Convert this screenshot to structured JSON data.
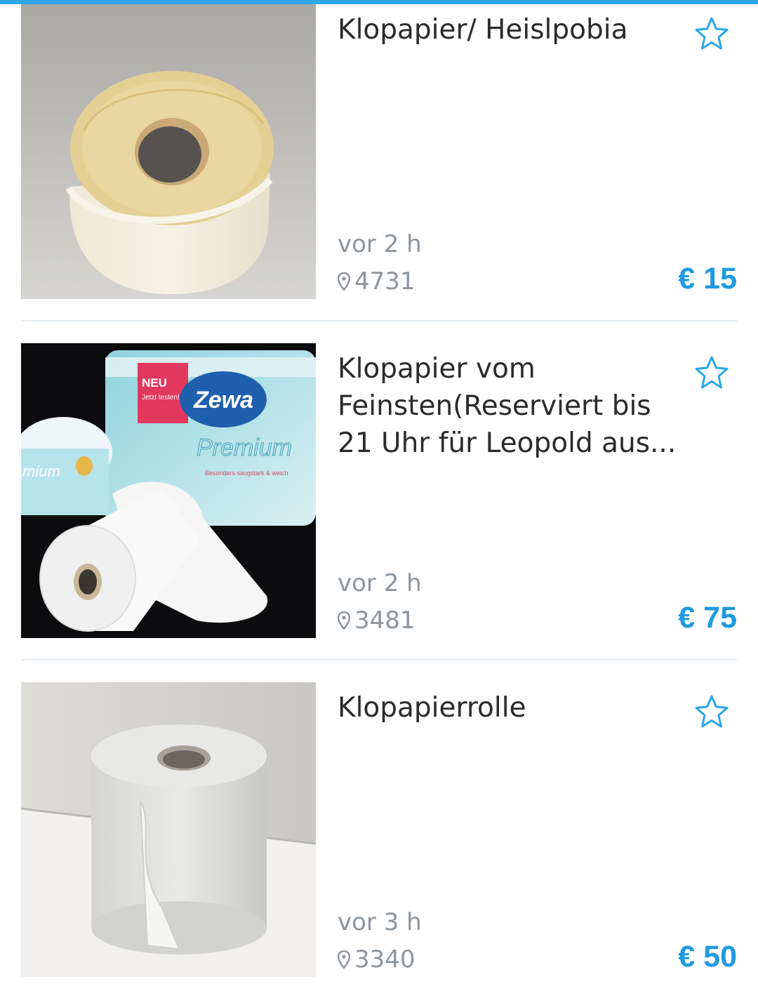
{
  "listings": [
    {
      "title": "Klopapier/ Heislpobia",
      "age": "vor 2 h",
      "location": "4731",
      "price": "€ 15"
    },
    {
      "title": "Klopapier vom Feinsten(Reserviert bis 21 Uhr für Leopold aus...",
      "age": "vor 2 h",
      "location": "3481",
      "price": "€ 75",
      "package_text": {
        "badge": "NEU",
        "badge_sub": "Jetzt testen!",
        "brand": "Zewa",
        "line": "Premium",
        "claim": "Besonders saugstark & weich",
        "small_roll_line": "mium"
      }
    },
    {
      "title": "Klopapierrolle",
      "age": "vor 3 h",
      "location": "3340",
      "price": "€ 50"
    }
  ],
  "colors": {
    "accent": "#2aa7e8",
    "price": "#1e9ae0",
    "meta_text": "#8d959c",
    "title_text": "#2b2b2b",
    "divider": "#e4ecf1"
  },
  "icons": {
    "favorite": "star-outline-icon",
    "location": "map-pin-icon"
  }
}
